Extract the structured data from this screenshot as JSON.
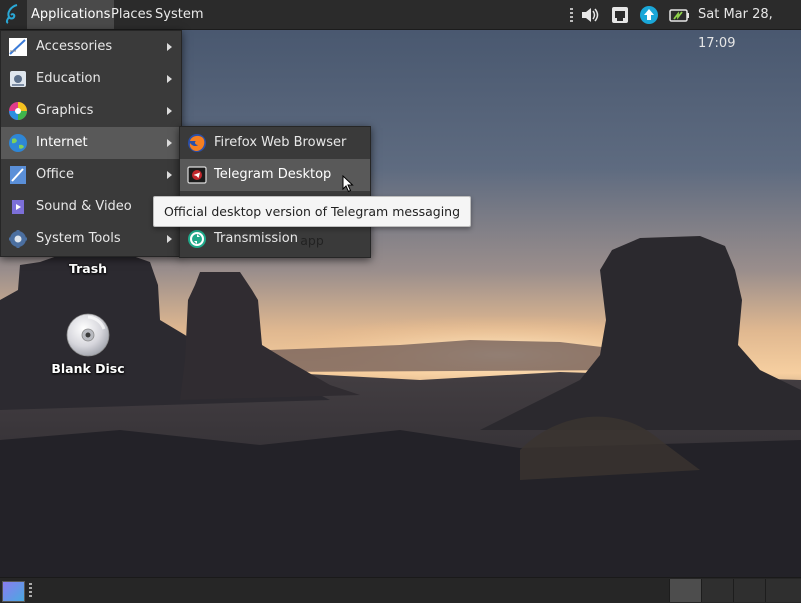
{
  "top_panel": {
    "menus": {
      "applications": "Applications",
      "places": "Places",
      "system": "System"
    },
    "tray_icons": [
      "volume-icon",
      "network-icon",
      "update-icon",
      "battery-icon"
    ],
    "clock": "Sat Mar 28, 17:09"
  },
  "app_menu": {
    "items": [
      {
        "label": "Accessories",
        "icon": "accessories-icon"
      },
      {
        "label": "Education",
        "icon": "education-icon"
      },
      {
        "label": "Graphics",
        "icon": "graphics-icon"
      },
      {
        "label": "Internet",
        "icon": "internet-icon"
      },
      {
        "label": "Office",
        "icon": "office-icon"
      },
      {
        "label": "Sound & Video",
        "icon": "sound-video-icon"
      },
      {
        "label": "System Tools",
        "icon": "system-tools-icon"
      }
    ],
    "active": "Internet"
  },
  "internet_submenu": {
    "items": [
      {
        "label": "Firefox Web Browser",
        "icon": "firefox-icon"
      },
      {
        "label": "Telegram Desktop",
        "icon": "telegram-icon"
      },
      {
        "label": "Transmission",
        "icon": "transmission-icon"
      }
    ],
    "active": "Telegram Desktop"
  },
  "tooltip": {
    "text": "Official desktop version of Telegram messaging app"
  },
  "desktop_icons": [
    {
      "label": "Trash",
      "icon": "trash-icon"
    },
    {
      "label": "Blank Disc",
      "icon": "disc-icon"
    }
  ],
  "bottom_panel": {
    "workspaces": 4,
    "active_workspace": 1
  },
  "colors": {
    "panel": "#2b2b2b",
    "menu": "#3a3a3a",
    "highlight": "#595959",
    "accent": "#1aa7d8"
  }
}
